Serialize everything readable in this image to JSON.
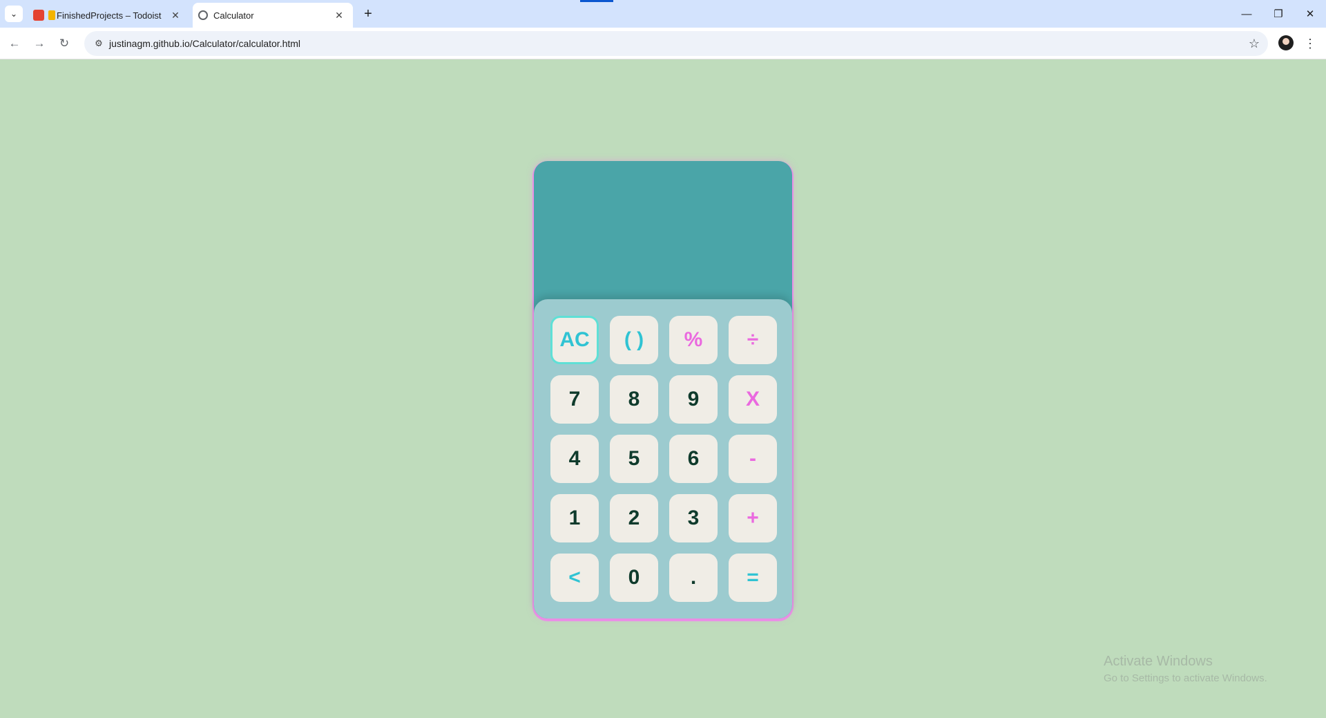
{
  "browser": {
    "tabs": [
      {
        "title": "FinishedProjects – Todoist",
        "close": "✕"
      },
      {
        "title": "Calculator",
        "close": "✕"
      }
    ],
    "new_tab": "+",
    "tab_search": "⌄",
    "url": "justinagm.github.io/Calculator/calculator.html",
    "nav": {
      "back": "←",
      "forward": "→",
      "reload": "↻"
    },
    "site_info": "⚙",
    "bookmark_star": "☆",
    "menu": "⋮",
    "window": {
      "minimize": "—",
      "restore": "❐",
      "close": "✕"
    }
  },
  "calculator": {
    "display": "",
    "keys": {
      "ac": "AC",
      "parens": "( )",
      "percent": "%",
      "divide": "÷",
      "seven": "7",
      "eight": "8",
      "nine": "9",
      "multiply": "X",
      "four": "4",
      "five": "5",
      "six": "6",
      "minus": "-",
      "one": "1",
      "two": "2",
      "three": "3",
      "plus": "+",
      "backspace": "<",
      "zero": "0",
      "decimal": ".",
      "equals": "="
    }
  },
  "watermark": {
    "title": "Activate Windows",
    "subtitle": "Go to Settings to activate Windows."
  }
}
